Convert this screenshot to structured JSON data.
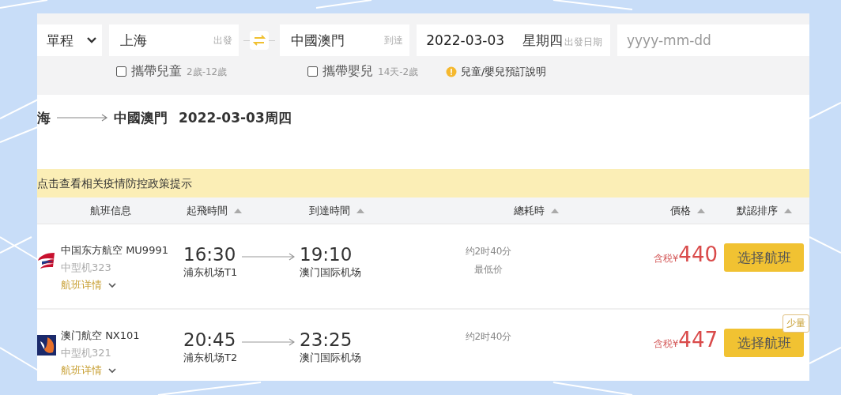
{
  "search": {
    "trip_type": {
      "value": "單程"
    },
    "from_field": {
      "value": "上海",
      "label": "出發"
    },
    "to_field": {
      "value": "中國澳門",
      "label": "到達"
    },
    "date_field": {
      "value": "2022-03-03",
      "weekday": "星期四",
      "label": "出發日期"
    },
    "return_field": {
      "placeholder": "yyyy-mm-dd"
    },
    "options": [
      {
        "label": "攜帶兒童",
        "hint": "2歲-12歲",
        "checked": false
      },
      {
        "label": "攜帶嬰兒",
        "hint": "14天-2歲",
        "checked": false
      }
    ],
    "info_link": "兒童/嬰兒預訂說明"
  },
  "route": {
    "from": "海",
    "to": "中國澳門",
    "date": "2022-03-03周四"
  },
  "notice": "点击查看相关疫情防控政策提示",
  "columns": [
    {
      "label": "航班信息",
      "sort_arrow": false
    },
    {
      "label": "起飛時間",
      "sort_arrow": true
    },
    {
      "label": "到達時間",
      "sort_arrow": true
    },
    {
      "label": "總耗時",
      "sort_arrow": true
    },
    {
      "label": "價格",
      "sort_arrow": true
    },
    {
      "label": "默認排序",
      "sort_arrow": true
    }
  ],
  "flights": [
    {
      "kind": "swallow",
      "airline": "中国东方航空 MU9991",
      "aircraft": "中型机323",
      "details": "航班详情",
      "dep_time": "16:30",
      "dep_airport": "浦东机场T1",
      "arr_time": "19:10",
      "arr_airport": "澳门国际机场",
      "duration": "约2时40分",
      "note": "最低价",
      "tax_label": "含税",
      "currency": "¥",
      "price": "440",
      "button": "选择航班"
    },
    {
      "kind": "bird-square",
      "airline": "澳门航空 NX101",
      "aircraft": "中型机321",
      "details": "航班详情",
      "dep_time": "20:45",
      "dep_airport": "浦东机场T2",
      "arr_time": "23:25",
      "arr_airport": "澳门国际机场",
      "duration": "约2时40分",
      "tax_label": "含税",
      "currency": "¥",
      "price": "447",
      "button": "选择航班",
      "badge": "少量"
    }
  ]
}
